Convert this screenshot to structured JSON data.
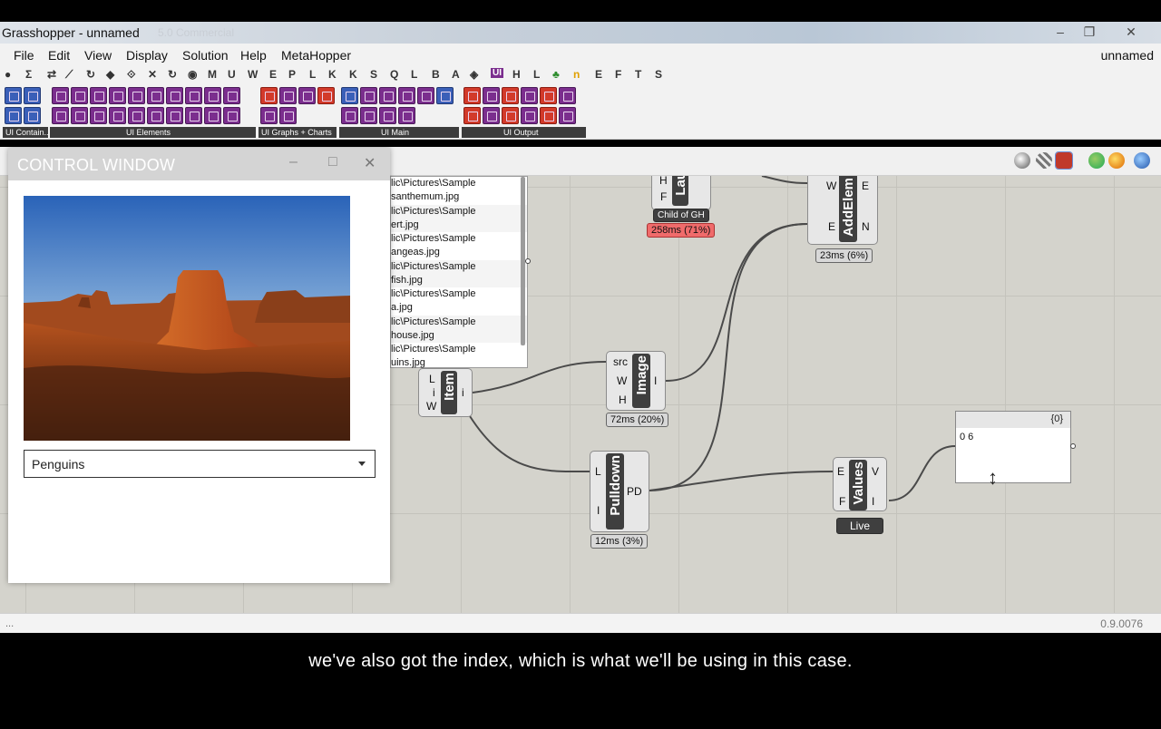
{
  "window": {
    "title": "Grasshopper - unnamed",
    "title_ghost": "5.0 Commercial",
    "doc_name": "unnamed"
  },
  "menu": [
    "File",
    "Edit",
    "View",
    "Display",
    "Solution",
    "Help",
    "MetaHopper"
  ],
  "tabs": [
    "●",
    "Σ",
    "⇄",
    "⟋",
    "↻",
    "◆",
    "⟐",
    "✕",
    "↻",
    "◉",
    "M",
    "U",
    "W",
    "E",
    "P",
    "L",
    "K",
    "K",
    "S",
    "Q",
    "L",
    "B",
    "A",
    "◈",
    "UI",
    "H",
    "L",
    "♣",
    "n",
    "E",
    "F",
    "T",
    "S"
  ],
  "ribbon_groups": [
    {
      "label": "UI Contain..."
    },
    {
      "label": "UI Elements"
    },
    {
      "label": "UI Graphs + Charts"
    },
    {
      "label": "UI Main"
    },
    {
      "label": "UI Output"
    }
  ],
  "control_window": {
    "title": "CONTROL WINDOW",
    "dropdown_value": "Penguins"
  },
  "file_list": [
    [
      "lic\\Pictures\\Sample",
      "santhemum.jpg"
    ],
    [
      "lic\\Pictures\\Sample",
      "ert.jpg"
    ],
    [
      "lic\\Pictures\\Sample",
      "angeas.jpg"
    ],
    [
      "lic\\Pictures\\Sample",
      "fish.jpg"
    ],
    [
      "lic\\Pictures\\Sample",
      "a.jpg"
    ],
    [
      "lic\\Pictures\\Sample",
      "house.jpg"
    ],
    [
      "lic\\Pictures\\Sample",
      "uins.jpg"
    ]
  ],
  "components": {
    "launch": {
      "name": "Lau",
      "inputs": [
        "H",
        "F"
      ],
      "sub": "Child of GH",
      "time": "258ms (71%)"
    },
    "addelem": {
      "name": "AddElem",
      "inputs": [
        "W",
        "E"
      ],
      "outputs": [
        "E",
        "N"
      ],
      "time": "23ms (6%)"
    },
    "item": {
      "name": "Item",
      "inputs": [
        "L",
        "i",
        "W"
      ],
      "outputs": [
        "i"
      ]
    },
    "image": {
      "name": "Image",
      "inputs": [
        "src",
        "W",
        "H"
      ],
      "outputs": [
        "I"
      ],
      "time": "72ms (20%)"
    },
    "pulldown": {
      "name": "Pulldown",
      "inputs": [
        "L",
        "I"
      ],
      "outputs": [
        "PD"
      ],
      "time": "12ms (3%)"
    },
    "values": {
      "name": "Values",
      "inputs": [
        "E",
        "F"
      ],
      "outputs": [
        "V",
        "I"
      ],
      "sub": "Live"
    },
    "panel": {
      "header": "{0}",
      "row": "0  6"
    }
  },
  "status": {
    "left": "...",
    "version": "0.9.0076"
  },
  "subtitle": "we've also got the index, which is what we'll be using in this case."
}
